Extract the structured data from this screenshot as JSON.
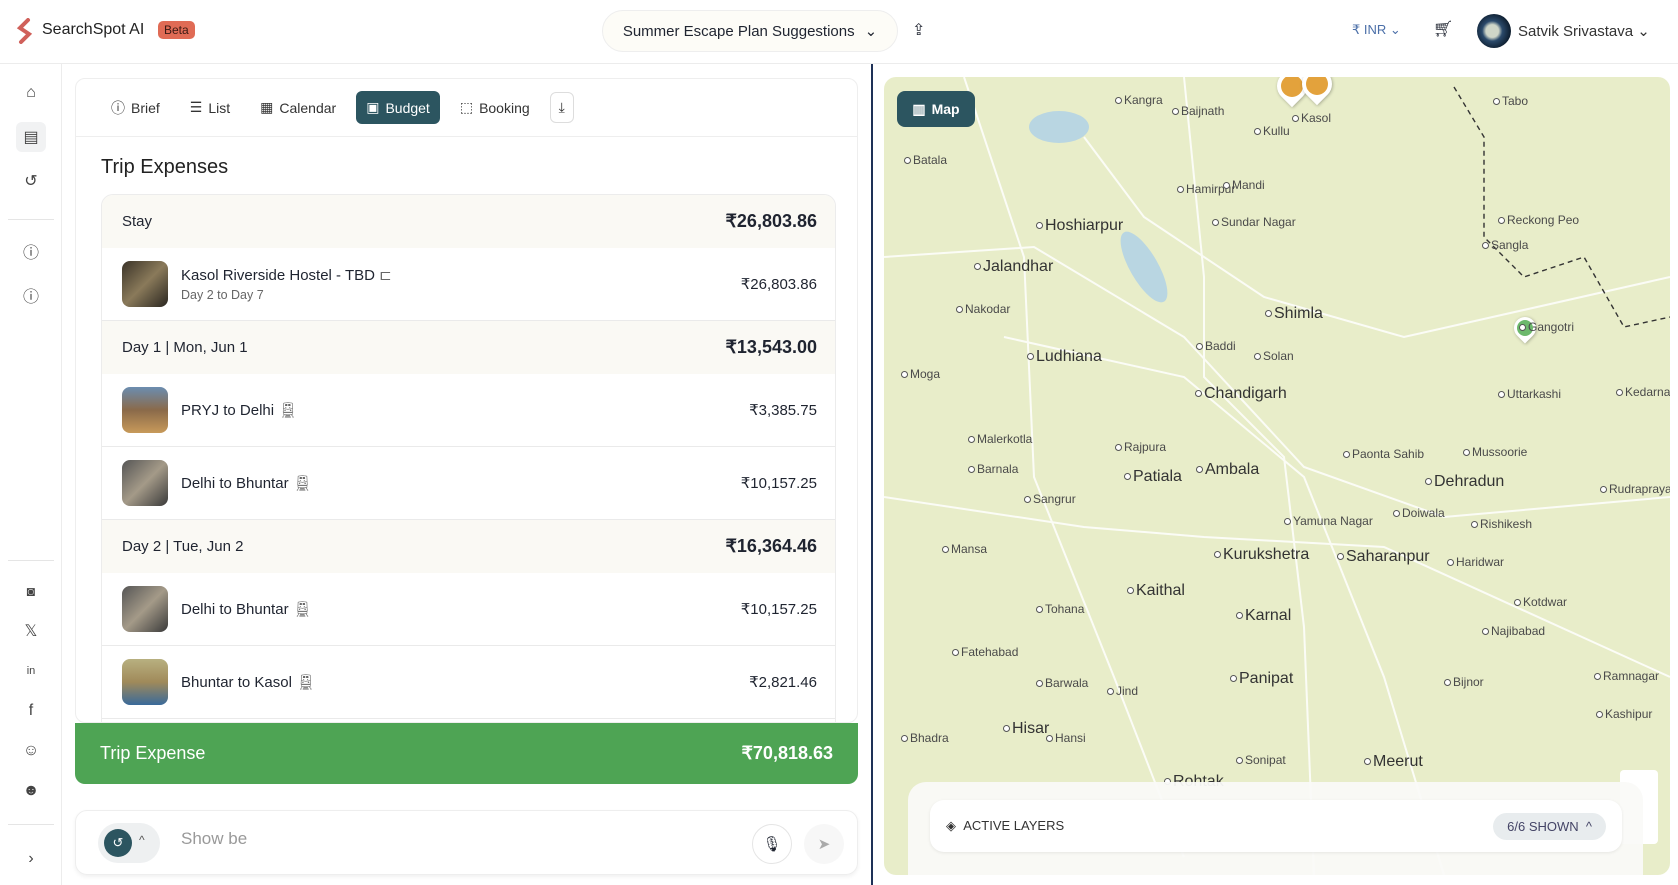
{
  "header": {
    "brand": "SearchSpot AI",
    "badge": "Beta",
    "plan_title": "Summer Escape Plan Suggestions",
    "currency": "INR",
    "currency_symbol": "₹",
    "user_name": "Satvik Srivastava"
  },
  "sidebar": {
    "items": [
      "home",
      "trips",
      "history",
      "help",
      "info"
    ],
    "social": [
      "instagram",
      "x",
      "linkedin",
      "facebook",
      "reddit",
      "discord"
    ]
  },
  "tabs": [
    {
      "label": "Brief",
      "icon": "info-icon"
    },
    {
      "label": "List",
      "icon": "list-icon"
    },
    {
      "label": "Calendar",
      "icon": "calendar-icon"
    },
    {
      "label": "Budget",
      "icon": "wallet-icon",
      "active": true
    },
    {
      "label": "Booking",
      "icon": "booking-icon"
    }
  ],
  "expenses": {
    "title": "Trip Expenses",
    "groups": [
      {
        "label": "Stay",
        "total": "₹26,803.86",
        "items": [
          {
            "name": "Kasol Riverside Hostel - TBD",
            "sub": "Day 2 to Day 7",
            "amount": "₹26,803.86",
            "icon": "bed-icon"
          }
        ]
      },
      {
        "label": "Day 1 | Mon, Jun 1",
        "total": "₹13,543.00",
        "items": [
          {
            "name": "PRYJ to Delhi",
            "amount": "₹3,385.75",
            "icon": "train-icon"
          },
          {
            "name": "Delhi to Bhuntar",
            "amount": "₹10,157.25",
            "icon": "train-icon"
          }
        ]
      },
      {
        "label": "Day 2 | Tue, Jun 2",
        "total": "₹16,364.46",
        "items": [
          {
            "name": "Delhi to Bhuntar",
            "amount": "₹10,157.25",
            "icon": "train-icon"
          },
          {
            "name": "Bhuntar to Kasol",
            "amount": "₹2,821.46",
            "icon": "train-icon"
          }
        ]
      }
    ],
    "total_label": "Trip Expense",
    "total": "₹70,818.63"
  },
  "chat": {
    "value": "Show be"
  },
  "map": {
    "button": "Map",
    "layers_label": "ACTIVE LAYERS",
    "layers_shown": "6/6 SHOWN",
    "labels": [
      "Kangra",
      "Baijnath",
      "Kullu",
      "Kasol",
      "Tabo",
      "Batala",
      "Hamirpur",
      "Mandi",
      "Hoshiarpur",
      "Sundar Nagar",
      "Reckong Peo",
      "Jalandhar",
      "Sangla",
      "Nakodar",
      "Shimla",
      "Gangotri",
      "Ludhiana",
      "Baddi",
      "Solan",
      "Moga",
      "Chandigarh",
      "Uttarkashi",
      "Kedarnath",
      "Malerkotla",
      "Rajpura",
      "Patiala",
      "Ambala",
      "Barnala",
      "Paonta Sahib",
      "Mussoorie",
      "Dehradun",
      "Rudraprayag",
      "Sangrur",
      "Yamuna Nagar",
      "Doiwala",
      "Rishikesh",
      "Kurukshetra",
      "Saharanpur",
      "Haridwar",
      "Mansa",
      "Kaithal",
      "Tohana",
      "Karnal",
      "Kotdwar",
      "Fatehabad",
      "Najibabad",
      "Barwala",
      "Jind",
      "Panipat",
      "Bijnor",
      "Ramnagar",
      "Kashipur",
      "Hisar",
      "Hansi",
      "Bhadra",
      "Sonipat",
      "Meerut",
      "Rohtak"
    ]
  },
  "colors": {
    "accent": "#2c5560",
    "total_bar": "#4ea454",
    "beta": "#e06b55",
    "map_bg": "#e8edc9",
    "divider": "#1e3157"
  }
}
